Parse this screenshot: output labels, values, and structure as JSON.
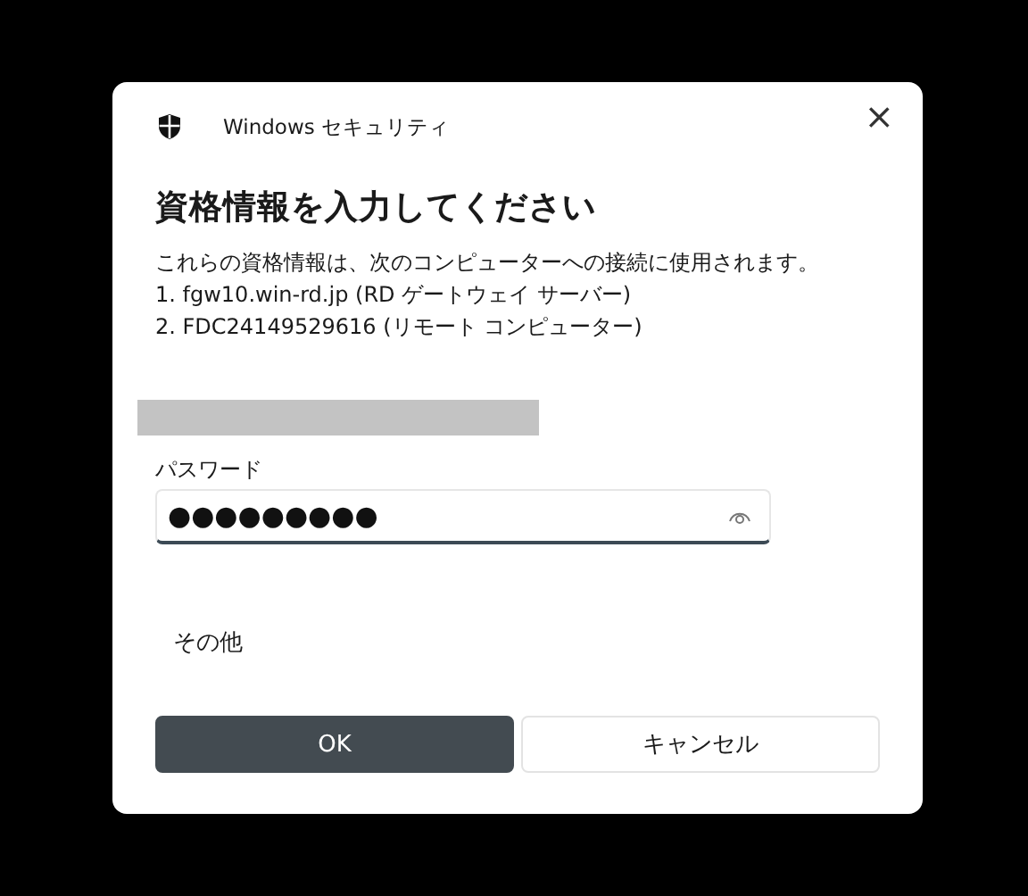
{
  "window": {
    "title": "Windows セキュリティ",
    "close": "×"
  },
  "heading": "資格情報を入力してください",
  "description": [
    "これらの資格情報は、次のコンピューターへの接続に使用されます。",
    "1. fgw10.win-rd.jp (RD ゲートウェイ サーバー)",
    "2. FDC24149529616 (リモート コンピューター)"
  ],
  "username": {
    "redacted": true
  },
  "password": {
    "label": "パスワード",
    "value": "●●●●●●●●●"
  },
  "more_choices": "その他",
  "buttons": [
    {
      "label": "OK",
      "kind": "primary"
    },
    {
      "label": "キャンセル",
      "kind": "secondary"
    }
  ]
}
